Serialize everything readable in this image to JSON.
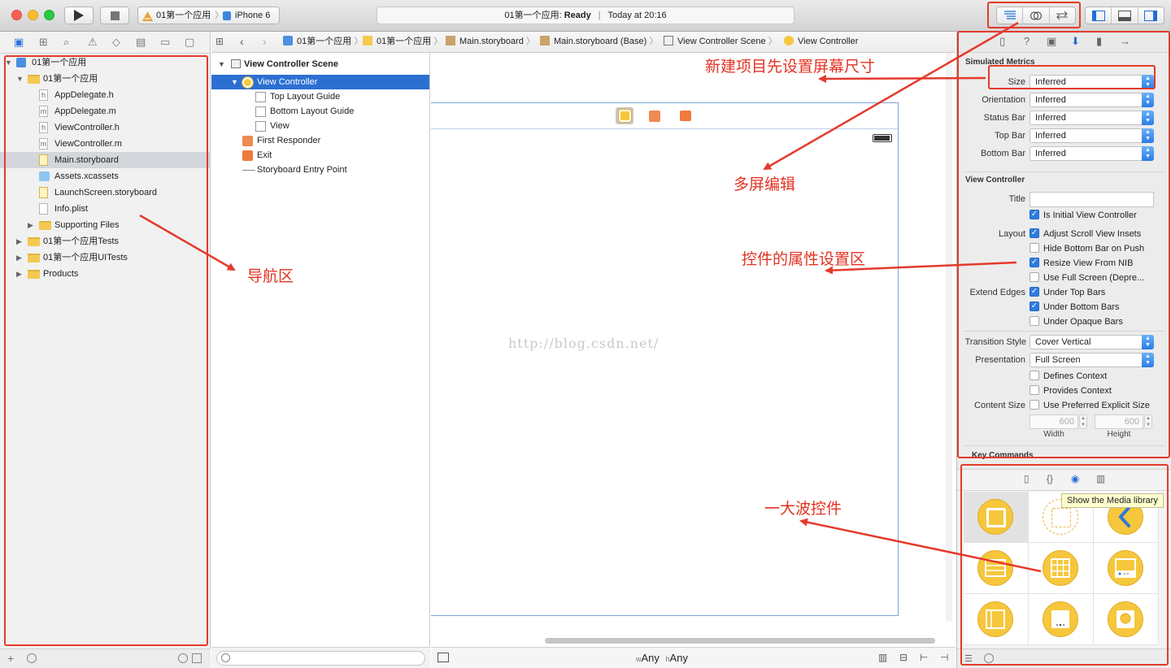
{
  "toolbar": {
    "scheme_project": "01第一个应用",
    "scheme_device": "iPhone 6",
    "activity_project": "01第一个应用:",
    "activity_status": "Ready",
    "activity_time": "Today at 20:16"
  },
  "navigator": {
    "items": [
      {
        "label": "01第一个应用",
        "kind": "project",
        "depth": 0,
        "expanded": true
      },
      {
        "label": "01第一个应用",
        "kind": "folder",
        "depth": 1,
        "expanded": true
      },
      {
        "label": "AppDelegate.h",
        "kind": "file",
        "badge": "h",
        "depth": 2
      },
      {
        "label": "AppDelegate.m",
        "kind": "file",
        "badge": "m",
        "depth": 2
      },
      {
        "label": "ViewController.h",
        "kind": "file",
        "badge": "h",
        "depth": 2
      },
      {
        "label": "ViewController.m",
        "kind": "file",
        "badge": "m",
        "depth": 2
      },
      {
        "label": "Main.storyboard",
        "kind": "storyboard",
        "depth": 2,
        "selected": true
      },
      {
        "label": "Assets.xcassets",
        "kind": "assets",
        "depth": 2
      },
      {
        "label": "LaunchScreen.storyboard",
        "kind": "storyboard",
        "depth": 2
      },
      {
        "label": "Info.plist",
        "kind": "file",
        "badge": "",
        "depth": 2
      },
      {
        "label": "Supporting Files",
        "kind": "folder",
        "depth": 2,
        "expanded": false
      },
      {
        "label": "01第一个应用Tests",
        "kind": "folder",
        "depth": 1,
        "expanded": false
      },
      {
        "label": "01第一个应用UITests",
        "kind": "folder",
        "depth": 1,
        "expanded": false
      },
      {
        "label": "Products",
        "kind": "folder",
        "depth": 1,
        "expanded": false
      }
    ]
  },
  "jumpbar": {
    "crumbs": [
      "01第一个应用",
      "01第一个应用",
      "Main.storyboard",
      "Main.storyboard (Base)",
      "View Controller Scene",
      "View Controller"
    ]
  },
  "outline": {
    "scene_title": "View Controller Scene",
    "items": [
      {
        "label": "View Controller",
        "depth": 1,
        "selected": true,
        "kind": "vc"
      },
      {
        "label": "Top Layout Guide",
        "depth": 2,
        "kind": "guide"
      },
      {
        "label": "Bottom Layout Guide",
        "depth": 2,
        "kind": "guide"
      },
      {
        "label": "View",
        "depth": 2,
        "kind": "view"
      },
      {
        "label": "First Responder",
        "depth": 1,
        "kind": "responder"
      },
      {
        "label": "Exit",
        "depth": 1,
        "kind": "exit"
      },
      {
        "label": "Storyboard Entry Point",
        "depth": 1,
        "kind": "entry"
      }
    ]
  },
  "canvas": {
    "watermark": "http://blog.csdn.net/",
    "size_class_w_prefix": "w",
    "size_class_w": "Any",
    "size_class_h_prefix": "h",
    "size_class_h": "Any"
  },
  "inspector": {
    "simulated_metrics_title": "Simulated Metrics",
    "metrics": [
      {
        "label": "Size",
        "value": "Inferred"
      },
      {
        "label": "Orientation",
        "value": "Inferred"
      },
      {
        "label": "Status Bar",
        "value": "Inferred"
      },
      {
        "label": "Top Bar",
        "value": "Inferred"
      },
      {
        "label": "Bottom Bar",
        "value": "Inferred"
      }
    ],
    "vc_title": "View Controller",
    "title_label": "Title",
    "title_value": "",
    "initial_vc_label": "Is Initial View Controller",
    "layout_label": "Layout",
    "layout_checks": [
      {
        "label": "Adjust Scroll View Insets",
        "checked": true
      },
      {
        "label": "Hide Bottom Bar on Push",
        "checked": false
      },
      {
        "label": "Resize View From NIB",
        "checked": true
      },
      {
        "label": "Use Full Screen (Depre...",
        "checked": false
      }
    ],
    "extend_label": "Extend Edges",
    "extend_checks": [
      {
        "label": "Under Top Bars",
        "checked": true
      },
      {
        "label": "Under Bottom Bars",
        "checked": true
      },
      {
        "label": "Under Opaque Bars",
        "checked": false
      }
    ],
    "transition_label": "Transition Style",
    "transition_value": "Cover Vertical",
    "presentation_label": "Presentation",
    "presentation_value": "Full Screen",
    "defines_context": "Defines Context",
    "provides_context": "Provides Context",
    "content_size_label": "Content Size",
    "preferred_size": "Use Preferred Explicit Size",
    "width_value": "600",
    "height_value": "600",
    "width_label": "Width",
    "height_label": "Height",
    "key_commands": "Key Commands"
  },
  "library": {
    "tooltip": "Show the Media library"
  },
  "annotations": {
    "screen_size": "新建项目先设置屏幕尺寸",
    "multi_editor": "多屏编辑",
    "inspector_area": "控件的属性设置区",
    "navigator_area": "导航区",
    "controls": "一大波控件"
  },
  "colors": {
    "annotation_red": "#e43a2c",
    "selection_blue": "#2c6fd2",
    "library_yellow": "#f6c73c"
  }
}
